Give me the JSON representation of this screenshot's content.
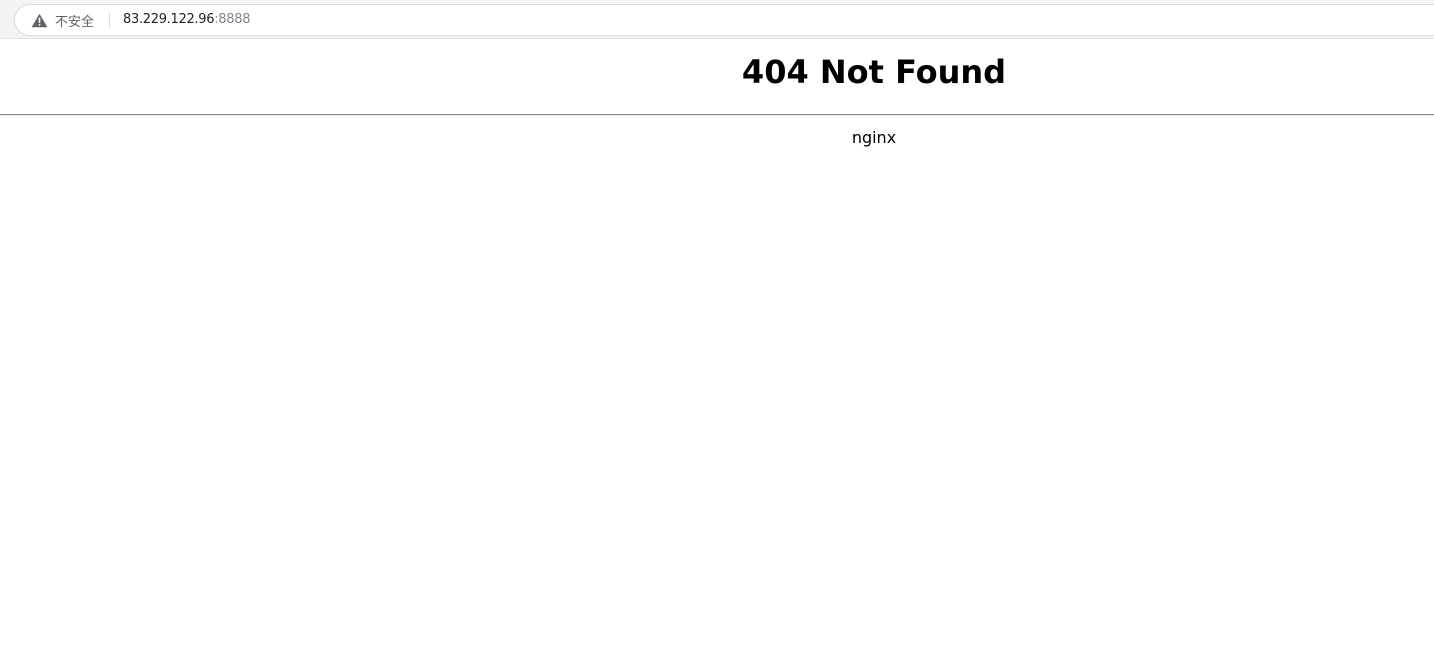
{
  "browser": {
    "security_label": "不安全",
    "security_icon": "warning-triangle-icon",
    "address": {
      "host": "83.229.122.96",
      "port": ":8888"
    }
  },
  "page": {
    "heading": "404 Not Found",
    "server": "nginx"
  },
  "colors": {
    "warning_icon": "#5f6368",
    "rule": "#8a8a8a"
  }
}
